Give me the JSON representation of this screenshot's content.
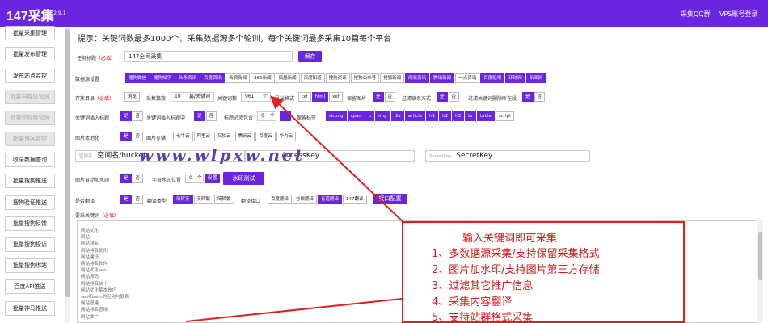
{
  "app": {
    "brand": "147采集",
    "version": "v1.2.9.1",
    "nav_links": [
      "采集QQ群",
      "VPS账号登录"
    ]
  },
  "sidebar": {
    "items": [
      {
        "label": "批量采集管理",
        "disabled": false
      },
      {
        "label": "批量发布管理",
        "disabled": false
      },
      {
        "label": "发布站点监控",
        "disabled": false
      },
      {
        "label": "批量自媒体管理",
        "disabled": true
      },
      {
        "label": "批量短视频管理",
        "disabled": true
      },
      {
        "label": "批量博客监控",
        "disabled": true
      },
      {
        "label": "收录数据查询",
        "disabled": false
      },
      {
        "label": "批量搜狗推送",
        "disabled": false
      },
      {
        "label": "搜狗验证推送",
        "disabled": false
      },
      {
        "label": "批量搜狗反馈",
        "disabled": false
      },
      {
        "label": "批量搜狗投诉",
        "disabled": false
      },
      {
        "label": "批量搜狗绑站",
        "disabled": false
      },
      {
        "label": "百度API推送",
        "disabled": false
      },
      {
        "label": "批量神马推送",
        "disabled": false
      }
    ]
  },
  "tip": "提示：关键词数最多1000个，采集数据源多个轮训，每个关键词最多采集10篇每个平台",
  "form": {
    "required": "（必填）",
    "task_title_label": "任务标题",
    "task_title_value": "147全网采集",
    "save_button": "保存",
    "source_label": "数据源设置",
    "sources": [
      {
        "label": "搜狗微信",
        "on": true
      },
      {
        "label": "搜狗知乎",
        "on": true
      },
      {
        "label": "头条资讯",
        "on": true
      },
      {
        "label": "百度资讯",
        "on": true
      },
      {
        "label": "新浪新闻",
        "on": false
      },
      {
        "label": "360新闻",
        "on": false
      },
      {
        "label": "凤凰新闻",
        "on": false
      },
      {
        "label": "百度知道",
        "on": false
      },
      {
        "label": "搜狗资讯",
        "on": false
      },
      {
        "label": "搜狗公众号",
        "on": false
      },
      {
        "label": "搜狐新闻",
        "on": false
      },
      {
        "label": "网易资讯",
        "on": true
      },
      {
        "label": "腾讯新闻",
        "on": true
      },
      {
        "label": "一点资讯",
        "on": false
      },
      {
        "label": "百度贴吧",
        "on": true
      },
      {
        "label": "环球网",
        "on": true
      },
      {
        "label": "新闻网",
        "on": true
      }
    ],
    "store_label": "存放目录",
    "store_opts": [
      {
        "label": "浏览",
        "on": false
      }
    ],
    "collect_count_label": "采集篇数",
    "collect_count_value": "10",
    "collect_count_unit": "篇/关键词",
    "kw_count_label": "关键词数",
    "kw_count_value": "961",
    "kw_count_unit": "个",
    "export_label": "导出格式",
    "export_opts": [
      {
        "label": "txt",
        "on": false
      },
      {
        "label": "html",
        "on": true
      },
      {
        "label": "xxf",
        "on": false
      }
    ],
    "keep_img_label": "保留图片",
    "yes": "是",
    "no": "否",
    "filter_contact_label": "过滤联系方式",
    "filter_kw_label": "过滤关键词删除所在段",
    "kw_insert_title_label": "关键词插入标题",
    "kw_insert_mid_label": "关键词插入标题中",
    "title_must_label": "标题必须包含",
    "title_must_value": "0",
    "keep_tags_label": "保留标签",
    "tags": [
      {
        "label": "strong",
        "on": true
      },
      {
        "label": "span",
        "on": true
      },
      {
        "label": "p",
        "on": true
      },
      {
        "label": "img",
        "on": true
      },
      {
        "label": "div",
        "on": true
      },
      {
        "label": "article",
        "on": true
      },
      {
        "label": "h1",
        "on": true
      },
      {
        "label": "h2",
        "on": true
      },
      {
        "label": "h3",
        "on": true
      },
      {
        "label": "br",
        "on": true
      },
      {
        "label": "table",
        "on": true
      },
      {
        "label": "script",
        "on": false
      }
    ],
    "img_local_label": "图片本地化",
    "img_storage_label": "图片存储",
    "storage_opts": [
      {
        "label": "七牛云",
        "on": false
      },
      {
        "label": "阿里云",
        "on": false
      },
      {
        "label": "又拍云",
        "on": false
      },
      {
        "label": "腾讯云",
        "on": false
      },
      {
        "label": "百度云",
        "on": false
      },
      {
        "label": "华为云",
        "on": false
      }
    ],
    "space_placeholder": "空间名",
    "space_value": "空间名/bucket",
    "access_value": "AccessKey",
    "secret_prefix": "SecretKey",
    "secret_value": "SecretKey",
    "watermark_label": "图片自动加水印",
    "alpha_label": "字母水印位置",
    "alpha_value": "0",
    "alpha_unit": "个",
    "setting_button": "设置",
    "wm_test_button": "水印测试",
    "translate_label": "是否翻译",
    "translate_type_label": "翻译类型",
    "translate_types": [
      {
        "label": "简转英",
        "on": true
      },
      {
        "label": "英转繁",
        "on": false
      },
      {
        "label": "简转繁",
        "on": false
      }
    ],
    "translate_api_label": "翻译接口",
    "translate_apis": [
      {
        "label": "百度翻译",
        "on": false
      },
      {
        "label": "谷歌翻译",
        "on": false
      },
      {
        "label": "有道翻译",
        "on": true
      },
      {
        "label": "147翻译",
        "on": false
      }
    ],
    "api_config_button": "接口配置",
    "collect_kw_label": "要采关键词"
  },
  "watermark_text": "www.wlpxw.net",
  "keywords": [
    "网站优化",
    "网站",
    "网站排名",
    "网站排名优化",
    "网站建设",
    "网站排名软件",
    "网站优化seo",
    "网站源码",
    "网站排名前十",
    "网站优化基本技巧",
    "seo和sem的区别与联系",
    "网站搭建",
    "网站排名查询",
    "网站推广"
  ],
  "callout": {
    "title": "输入关键词即可采集",
    "lines": [
      "1、多数据源采集/支持保留采集格式",
      "2、图片加水印/支持图片第三方存储",
      "3、过滤其它推广信息",
      "4、采集内容翻译",
      "5、支持站群格式采集"
    ]
  }
}
